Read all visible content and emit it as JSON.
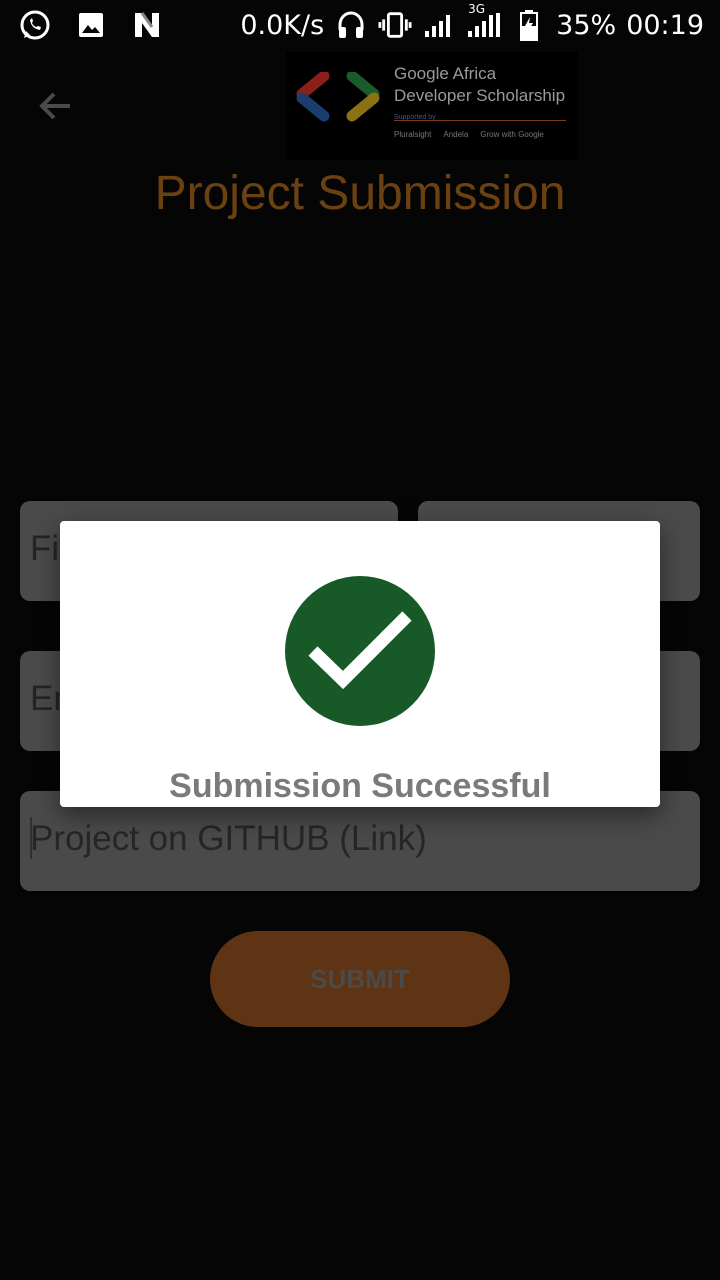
{
  "status_bar": {
    "network_speed": "0.0K/s",
    "network_type": "3G",
    "battery_percent": "35%",
    "time": "00:19",
    "left_icons": [
      "whatsapp-icon",
      "gallery-icon",
      "n-icon"
    ],
    "right_icons": [
      "headphones-icon",
      "vibrate-icon",
      "signal-icon",
      "signal-3g-icon",
      "battery-icon"
    ]
  },
  "header": {
    "back_icon": "arrow-left-icon",
    "banner": {
      "line1": "Google Africa",
      "line2": "Developer Scholarship",
      "supported_by": "Supported by",
      "sponsors": [
        "Pluralsight",
        "Andela",
        "Grow with Google"
      ]
    },
    "title": "Project Submission"
  },
  "form": {
    "first_name_placeholder": "Fi",
    "email_placeholder": "Em",
    "github_placeholder": "Project on GITHUB (Link)",
    "submit_label": "SUBMIT"
  },
  "dialog": {
    "message": "Submission Successful",
    "icon": "checkmark-icon"
  },
  "colors": {
    "accent": "#6b4112",
    "success": "#185a27",
    "background": "#050505"
  }
}
